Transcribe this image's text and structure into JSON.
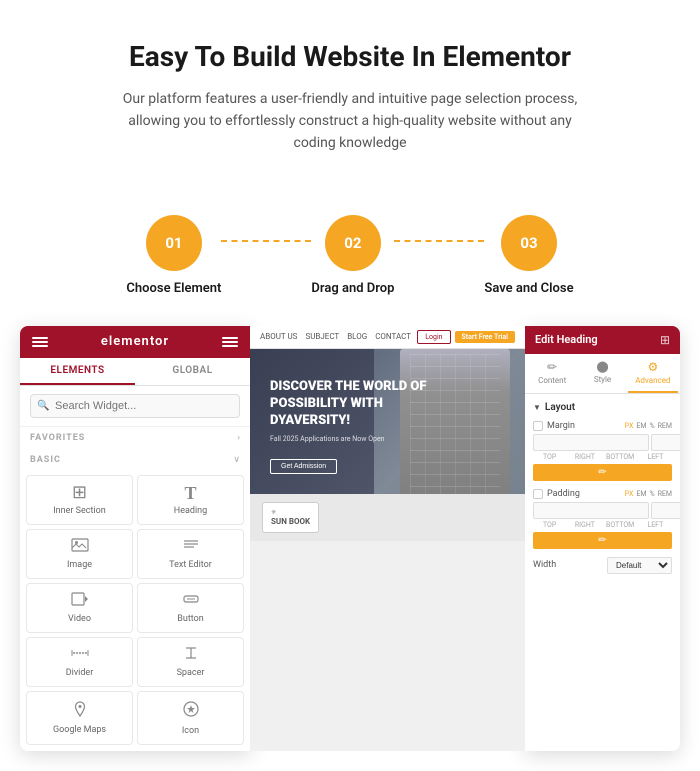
{
  "hero": {
    "title": "Easy To Build Website In Elementor",
    "subtitle": "Our platform features a user-friendly and intuitive page selection process, allowing you to effortlessly construct a high-quality website without any coding knowledge"
  },
  "steps": [
    {
      "number": "01",
      "label": "Choose Element"
    },
    {
      "number": "02",
      "label": "Drag and Drop"
    },
    {
      "number": "03",
      "label": "Save and Close"
    }
  ],
  "sidebar": {
    "title": "elementor",
    "tabs": [
      "ELEMENTS",
      "GLOBAL"
    ],
    "search_placeholder": "Search Widget...",
    "sections": {
      "favorites": "FAVORITES",
      "basic": "BASIC"
    },
    "widgets": [
      {
        "icon": "⊞",
        "label": "Inner Section"
      },
      {
        "icon": "T",
        "label": "Heading"
      },
      {
        "icon": "🖼",
        "label": "Image"
      },
      {
        "icon": "≡",
        "label": "Text Editor"
      },
      {
        "icon": "▶",
        "label": "Video"
      },
      {
        "icon": "⬜",
        "label": "Button"
      },
      {
        "icon": "—",
        "label": "Divider"
      },
      {
        "icon": "↕",
        "label": "Spacer"
      },
      {
        "icon": "📍",
        "label": "Google Maps"
      },
      {
        "icon": "✦",
        "label": "Icon"
      }
    ]
  },
  "canvas": {
    "nav_links": [
      "ABOUT US",
      "SUBJECT",
      "BLOG",
      "CONTACT"
    ],
    "login_label": "Login",
    "cta_label": "Start Free Trial",
    "hero_title": "DISCOVER THE WORLD OF POSSIBILITY WITH DYAVERSITY!",
    "hero_sub": "Fall 2025 Applications are Now Open",
    "hero_btn": "Get Admission",
    "logo_text": "SUN BOOK"
  },
  "edit_panel": {
    "title": "Edit Heading",
    "tabs": [
      {
        "icon": "✏",
        "label": "Content"
      },
      {
        "icon": "🎨",
        "label": "Style"
      },
      {
        "icon": "⚙",
        "label": "Advanced"
      }
    ],
    "active_tab": "Advanced",
    "sections": {
      "layout": "Layout"
    },
    "margin_label": "Margin",
    "margin_units": [
      "PX",
      "EM",
      "%",
      "REM"
    ],
    "margin_inputs": [
      "",
      "",
      "",
      ""
    ],
    "margin_sub_labels": [
      "TOP",
      "RIGHT",
      "BOTTOM",
      "LEFT"
    ],
    "padding_label": "Padding",
    "padding_units": [
      "PX",
      "EM",
      "%",
      "REM"
    ],
    "padding_inputs": [
      "",
      "",
      "",
      ""
    ],
    "padding_sub_labels": [
      "TOP",
      "RIGHT",
      "BOTTOM",
      "LEFT"
    ],
    "width_label": "Width",
    "width_default": "Default"
  }
}
